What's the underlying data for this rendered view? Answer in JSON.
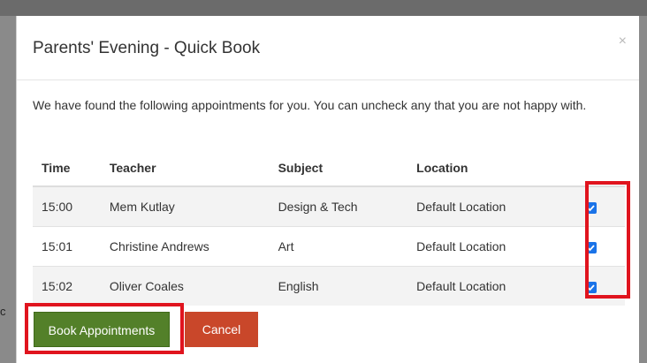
{
  "dialog": {
    "title": "Parents' Evening - Quick Book",
    "close_label": "×",
    "intro": "We have found the following appointments for you. You can uncheck any that you are not happy with."
  },
  "table": {
    "headers": {
      "time": "Time",
      "teacher": "Teacher",
      "subject": "Subject",
      "location": "Location"
    },
    "rows": [
      {
        "time": "15:00",
        "teacher": "Mem Kutlay",
        "subject": "Design & Tech",
        "location": "Default Location",
        "checked": true
      },
      {
        "time": "15:01",
        "teacher": "Christine Andrews",
        "subject": "Art",
        "location": "Default Location",
        "checked": true
      },
      {
        "time": "15:02",
        "teacher": "Oliver Coales",
        "subject": "English",
        "location": "Default Location",
        "checked": true
      }
    ]
  },
  "actions": {
    "book_label": "Book Appointments",
    "cancel_label": "Cancel"
  },
  "colors": {
    "book_button": "#538029",
    "cancel_button": "#c9472a",
    "highlight": "#e0141e",
    "checkbox": "#1a73e8"
  },
  "backdrop": {
    "left_text": "c"
  }
}
